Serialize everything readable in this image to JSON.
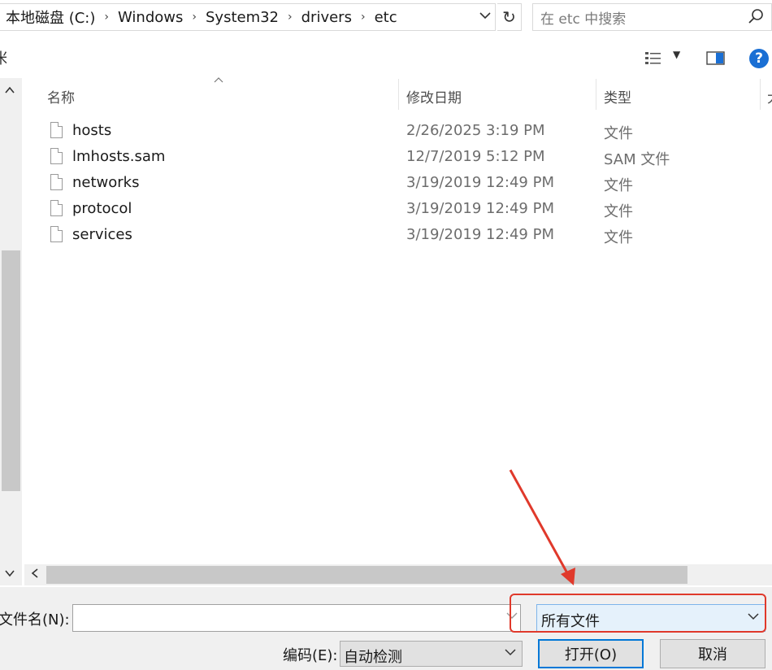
{
  "address": {
    "crumbs": [
      "本地磁盘 (C:)",
      "Windows",
      "System32",
      "drivers",
      "etc"
    ]
  },
  "search": {
    "placeholder": "在 etc 中搜索"
  },
  "toolbar": {
    "cut_label": "米"
  },
  "columns": {
    "name": "名称",
    "modified": "修改日期",
    "type": "类型",
    "size": "大"
  },
  "files": [
    {
      "name": "hosts",
      "modified": "2/26/2025 3:19 PM",
      "type": "文件"
    },
    {
      "name": "lmhosts.sam",
      "modified": "12/7/2019 5:12 PM",
      "type": "SAM 文件"
    },
    {
      "name": "networks",
      "modified": "3/19/2019 12:49 PM",
      "type": "文件"
    },
    {
      "name": "protocol",
      "modified": "3/19/2019 12:49 PM",
      "type": "文件"
    },
    {
      "name": "services",
      "modified": "3/19/2019 12:49 PM",
      "type": "文件"
    }
  ],
  "bottom": {
    "filename_label": "文件名(N):",
    "filename_value": "",
    "filetype_value": "所有文件",
    "encoding_label": "编码(E):",
    "encoding_value": "自动检测",
    "open_label": "打开(O)",
    "cancel_label": "取消"
  },
  "icons": {
    "help": "?",
    "refresh": "↻",
    "chevron": "⌄"
  },
  "colors": {
    "annotation_red": "#e0392b",
    "accent_blue": "#0078d7",
    "filetype_bg": "#e5f1fb"
  }
}
